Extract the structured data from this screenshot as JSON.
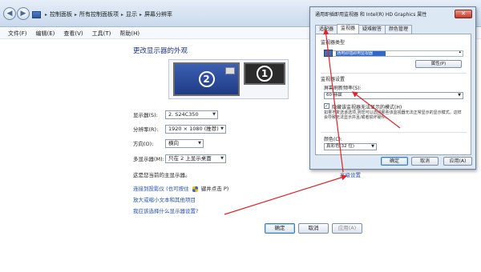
{
  "window": {
    "address_bar": {
      "crumbs": [
        "控制面板",
        "所有控制面板项",
        "显示",
        "屏幕分辨率"
      ]
    },
    "menu": [
      "文件(F)",
      "编辑(E)",
      "查看(V)",
      "工具(T)",
      "帮助(H)"
    ]
  },
  "main": {
    "title": "更改显示器的外观",
    "monitors": {
      "primary_number": "2",
      "secondary_number": "1"
    },
    "fields": {
      "display": {
        "label": "显示器(S):",
        "value": "2. S24C350"
      },
      "resolution": {
        "label": "分辨率(R):",
        "value": "1920 × 1080 (推荐)"
      },
      "orientation": {
        "label": "方向(O):",
        "value": "横向"
      },
      "multiple_displays": {
        "label": "多显示器(M):",
        "value": "只在 2 上显示桌面"
      }
    },
    "primary_note": "这是您当前的主显示器。",
    "advanced_link": "高级设置",
    "links": {
      "projector": "连接到投影仪 (也可按住",
      "projector_suffix": "键并点击 P)",
      "text_size": "放大或缩小文本和其他项目",
      "choose_settings": "我应该选择什么显示器设置?"
    },
    "buttons": {
      "ok": "确定",
      "cancel": "取消",
      "apply": "应用(A)"
    }
  },
  "dialog": {
    "title": "通用即插即用监视器 和 Intel(R) HD Graphics 属性",
    "close": "✕",
    "tabs": [
      "适配器",
      "监视器",
      "疑难解答",
      "颜色管理"
    ],
    "active_tab": 1,
    "monitor_type": {
      "label": "监视器类型",
      "item": "通用即插即用监视器"
    },
    "properties_button": "属性(P)",
    "monitor_settings": {
      "label": "监视器设置",
      "refresh_label": "屏幕刷新频率(S):",
      "refresh_value": "60 赫兹",
      "hide_modes": "隐藏该监视器无法显示的模式(H)",
      "warning": "如果不复选该选项,则您可以选择那些该监视器无法正常显示的显示模式。这样会导致无法显示并且/或者损坏硬件。"
    },
    "colors": {
      "label": "颜色(C):",
      "value": "真彩色(32 位)"
    },
    "buttons": {
      "ok": "确定",
      "cancel": "取消",
      "apply": "应用(A)"
    }
  },
  "colors": {
    "arrow_red": "#e0242a",
    "link_blue": "#1f4fb5",
    "title_blue": "#1e3287",
    "selection_blue": "#3267c8"
  }
}
